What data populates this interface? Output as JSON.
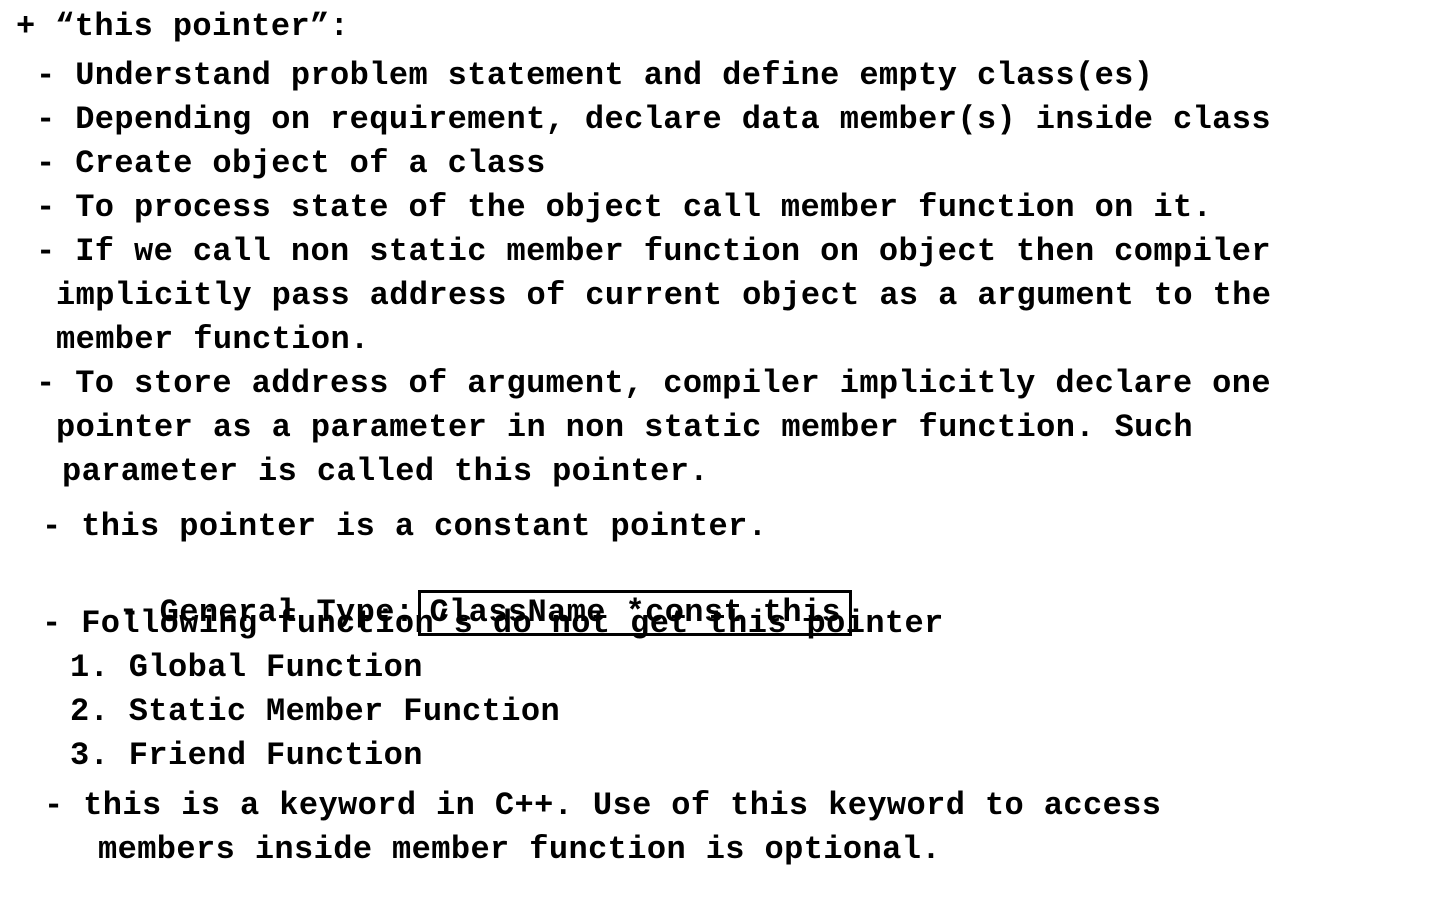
{
  "heading": "+ “this pointer”:",
  "bullets": {
    "b1": "- Understand problem statement and define empty class(es)",
    "b2": "- Depending on requirement, declare data member(s) inside class",
    "b3": "- Create object of a class",
    "b4": "- To process state of the object call member function on it.",
    "b5_l1": "- If we call non static member function on object then compiler",
    "b5_l2": "implicitly pass address of current object as a argument to the",
    "b5_l3": "member function.",
    "b6_l1": "- To store address of argument, compiler implicitly declare one",
    "b6_l2": "pointer as a parameter in non static member function. Such",
    "b6_l3": "parameter is called this pointer.",
    "b7": "- this pointer is a constant pointer.",
    "b8_label": "- General Type:",
    "b8_code": "ClassName *const this",
    "b9": "- Following function’s do not get this pointer",
    "list": {
      "i1": "1. Global Function",
      "i2": "2. Static Member Function",
      "i3": "3. Friend Function"
    },
    "b10_l1": "- this is a keyword in C++. Use of this keyword to access",
    "b10_l2": "members inside member function is optional."
  }
}
